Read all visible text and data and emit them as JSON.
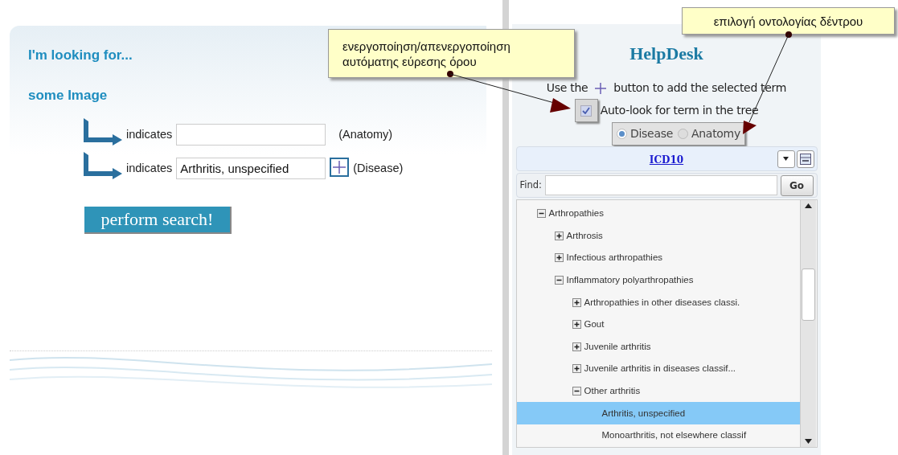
{
  "search_panel": {
    "heading": "I'm looking for...",
    "subheading": "some Image",
    "criteria": [
      {
        "relation": "indicates",
        "category": "(Anatomy)",
        "add_button": false
      },
      {
        "relation": "indicates",
        "value": "Arthritis, unspecified",
        "category": "(Disease)",
        "add_button": true
      }
    ],
    "submit": "perform search!"
  },
  "helpdesk": {
    "title": "HelpDesk",
    "hint_before": "Use the",
    "hint_after": "button to add the selected term",
    "auto_look": {
      "label": "Auto-look for term in the tree",
      "checked": true
    },
    "ontologies": [
      {
        "label": "Disease",
        "selected": true
      },
      {
        "label": "Anatomy",
        "selected": false
      }
    ],
    "tree_header": "ICD10",
    "find": {
      "label": "Find:",
      "button": "Go"
    },
    "tree": [
      {
        "label": "Arthropathies",
        "expanded": true,
        "selected": false,
        "children": [
          {
            "label": "Arthrosis",
            "expanded": false,
            "selected": false
          },
          {
            "label": "Infectious arthropathies",
            "expanded": false,
            "selected": false
          },
          {
            "label": "Inflammatory polyarthropathies",
            "expanded": true,
            "selected": false,
            "children": [
              {
                "label": "Arthropathies in other diseases classi.",
                "expanded": false,
                "selected": false
              },
              {
                "label": "Gout",
                "expanded": false,
                "selected": false
              },
              {
                "label": "Juvenile arthritis",
                "expanded": false,
                "selected": false
              },
              {
                "label": "Juvenile arthritis in diseases classif...",
                "expanded": false,
                "selected": false
              },
              {
                "label": "Other arthritis",
                "expanded": true,
                "selected": false,
                "children": [
                  {
                    "label": "Arthritis, unspecified",
                    "kind": "leaf",
                    "selected": true
                  },
                  {
                    "label": "Monoarthritis, not elsewhere classif",
                    "kind": "leaf",
                    "selected": false
                  }
                ]
              }
            ]
          }
        ]
      }
    ]
  },
  "callouts": [
    {
      "lines": [
        "ενεργοποίηση/απενεργοποίηση",
        "αυτόματης εύρεσης όρου"
      ]
    },
    {
      "lines": [
        "επιλογή οντολογίας δέντρου"
      ]
    }
  ]
}
